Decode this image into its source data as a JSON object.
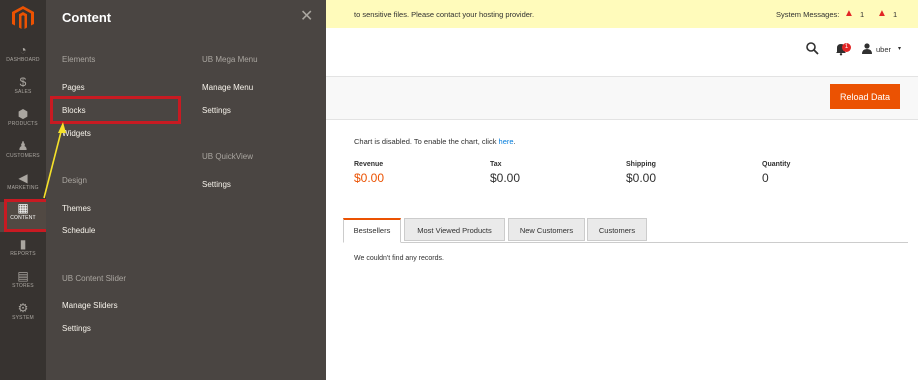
{
  "nav": {
    "items": [
      {
        "label": "DASHBOARD",
        "icon": "dashboard-icon"
      },
      {
        "label": "SALES",
        "icon": "dollar-icon"
      },
      {
        "label": "PRODUCTS",
        "icon": "cube-icon"
      },
      {
        "label": "CUSTOMERS",
        "icon": "person-icon"
      },
      {
        "label": "MARKETING",
        "icon": "megaphone-icon"
      },
      {
        "label": "CONTENT",
        "icon": "layout-icon"
      },
      {
        "label": "REPORTS",
        "icon": "bar-chart-icon"
      },
      {
        "label": "STORES",
        "icon": "store-icon"
      },
      {
        "label": "SYSTEM",
        "icon": "gear-icon"
      }
    ],
    "active": "CONTENT"
  },
  "flyout": {
    "title": "Content",
    "close_glyph": "✕",
    "groups": {
      "elements": {
        "title": "Elements",
        "links": [
          "Pages",
          "Blocks",
          "Widgets"
        ]
      },
      "design": {
        "title": "Design",
        "links": [
          "Themes",
          "Schedule"
        ]
      },
      "content_slider": {
        "title": "UB Content Slider",
        "links": [
          "Manage Sliders",
          "Settings"
        ]
      },
      "mega_menu": {
        "title": "UB Mega Menu",
        "links": [
          "Manage Menu",
          "Settings"
        ]
      },
      "quickview": {
        "title": "UB QuickView",
        "links": [
          "Settings"
        ]
      }
    },
    "highlighted": "Blocks"
  },
  "notice": {
    "text": "to sensitive files. Please contact your hosting provider.",
    "system_messages_label": "System Messages:",
    "warning_count_1": "1",
    "warning_count_2": "1",
    "colors": {
      "background": "#fffbbb",
      "warning": "#e22626"
    }
  },
  "header": {
    "notification_count": "1",
    "user_name": "uber",
    "caret": "▾"
  },
  "toolbar": {
    "reload_label": "Reload Data",
    "accent": "#eb5202"
  },
  "dashboard": {
    "chart_message": "Chart is disabled. To enable the chart, click ",
    "chart_link": "here",
    "chart_message_end": ".",
    "stats": [
      {
        "label": "Revenue",
        "value": "$0.00"
      },
      {
        "label": "Tax",
        "value": "$0.00"
      },
      {
        "label": "Shipping",
        "value": "$0.00"
      },
      {
        "label": "Quantity",
        "value": "0"
      }
    ],
    "tabs": [
      "Bestsellers",
      "Most Viewed Products",
      "New Customers",
      "Customers"
    ],
    "active_tab": "Bestsellers",
    "no_records": "We couldn't find any records."
  }
}
